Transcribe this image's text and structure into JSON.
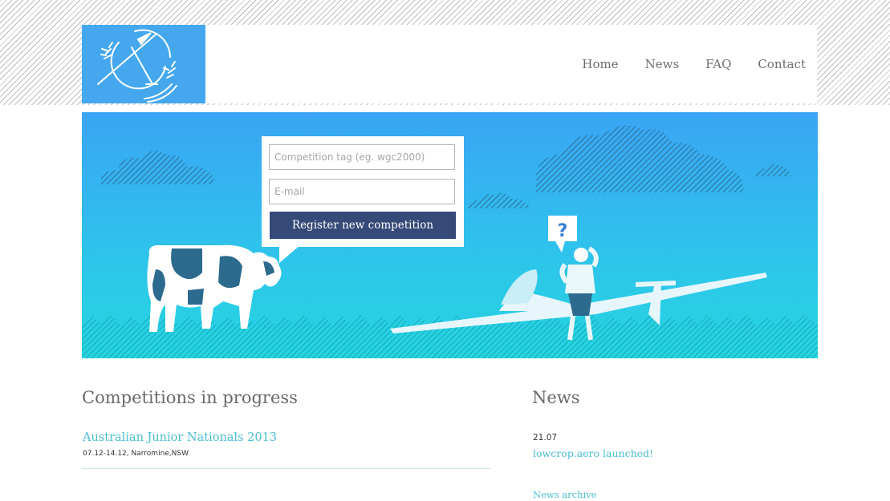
{
  "nav": {
    "items": [
      {
        "label": "Home"
      },
      {
        "label": "News"
      },
      {
        "label": "FAQ"
      },
      {
        "label": "Contact"
      }
    ]
  },
  "register_form": {
    "tag_placeholder": "Competition tag (eg. wgc2000)",
    "email_placeholder": "E-mail",
    "button_label": "Register new competition"
  },
  "hero": {
    "question_mark": "?"
  },
  "competitions": {
    "title": "Competitions in progress",
    "items": [
      {
        "name": "Australian Junior Nationals 2013",
        "meta": "07.12-14.12, Narromine,NSW"
      }
    ]
  },
  "news": {
    "title": "News",
    "items": [
      {
        "date": "21.07",
        "headline": "lowcrop.aero launched!"
      }
    ],
    "archive_label": "News archive"
  },
  "colors": {
    "logo_bg": "#45a8ef",
    "button_bg": "#354a78",
    "link": "#4bbfd0",
    "hero_top": "#3aa4f4",
    "hero_bottom": "#25d6e0"
  }
}
